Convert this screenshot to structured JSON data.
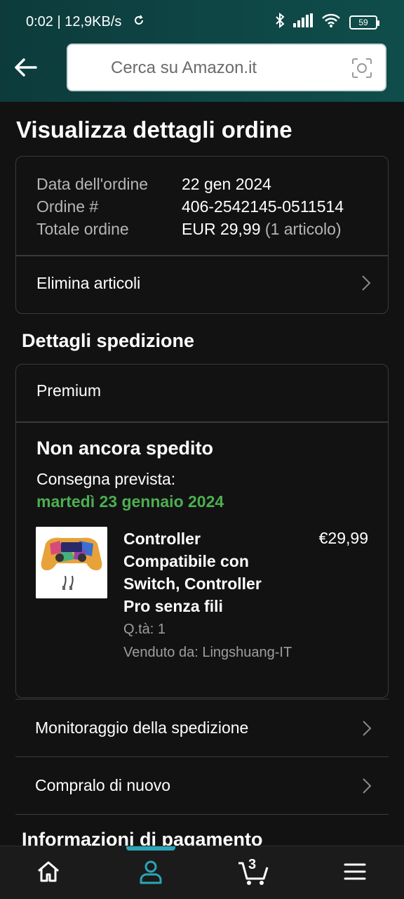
{
  "status_bar": {
    "time": "0:02 | 12,9KB/s",
    "battery": "59"
  },
  "header": {
    "search_placeholder": "Cerca su Amazon.it"
  },
  "page": {
    "title": "Visualizza dettagli ordine"
  },
  "order_summary": {
    "rows": [
      {
        "label": "Data dell'ordine",
        "value": "22 gen 2024"
      },
      {
        "label": "Ordine #",
        "value": "406-2542145-0511514"
      },
      {
        "label": "Totale ordine",
        "value": "EUR 29,99",
        "extra": "(1 articolo)"
      }
    ],
    "delete_items_label": "Elimina articoli"
  },
  "shipping": {
    "section_title": "Dettagli spedizione",
    "service": "Premium",
    "status": "Non ancora spedito",
    "eta_label": "Consegna prevista:",
    "eta_date": "martedì 23 gennaio 2024",
    "product": {
      "title": "Controller Compatibile con Switch, Controller Pro senza fili",
      "price": "€29,99",
      "quantity": "Q.tà: 1",
      "seller": "Venduto da: Lingshuang-IT"
    }
  },
  "actions": {
    "track": "Monitoraggio della spedizione",
    "buy_again": "Compralo di nuovo"
  },
  "payment": {
    "section_title": "Informazioni di pagamento"
  },
  "bottom_nav": {
    "cart_count": "3"
  },
  "colors": {
    "accent": "#2aa6b7",
    "eta_green": "#4caf50",
    "header_teal": "#0e4545"
  }
}
